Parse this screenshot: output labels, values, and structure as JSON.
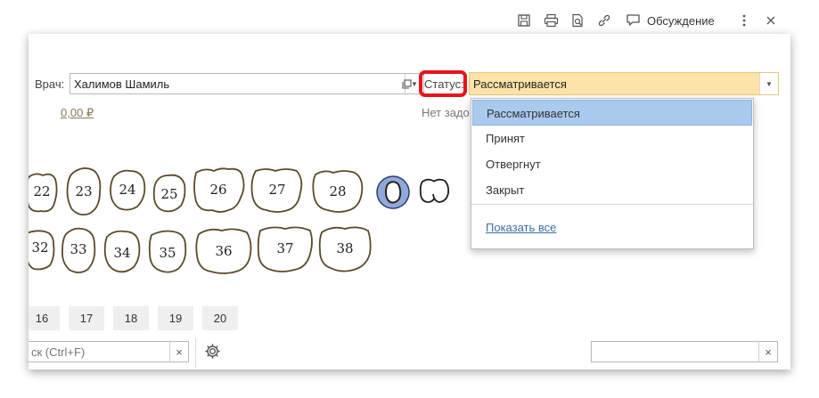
{
  "toolbar": {
    "discussion_label": "Обсуждение",
    "icons": [
      "save-icon",
      "print-icon",
      "preview-icon",
      "link-icon",
      "discussion-icon",
      "more-icon",
      "close-icon"
    ]
  },
  "doctor": {
    "label": "Врач:",
    "value": "Халимов Шамиль"
  },
  "amount": "0,00 ₽",
  "status": {
    "label": "Статус:",
    "value": "Рассматривается",
    "field_color": "#fde3a7"
  },
  "no_tasks_partial": "Нет задо",
  "status_menu": {
    "options": [
      "Рассматривается",
      "Принят",
      "Отвергнут",
      "Закрыт"
    ],
    "selected_index": 0,
    "show_all": "Показать все"
  },
  "teeth_upper": [
    "22",
    "23",
    "24",
    "25",
    "26",
    "27",
    "28"
  ],
  "teeth_lower": [
    "32",
    "33",
    "34",
    "35",
    "36",
    "37",
    "38"
  ],
  "number_buttons": [
    "16",
    "17",
    "18",
    "19",
    "20"
  ],
  "search": {
    "placeholder": "ск (Ctrl+F)",
    "clear": "×"
  },
  "right_field": {
    "value": "",
    "clear": "×"
  },
  "colors": {
    "highlight": "#e8141c",
    "selection": "#a9c9ef",
    "tooth_outline": "#5a4a2a",
    "tooth_selected_fill": "#8fa8d8"
  }
}
